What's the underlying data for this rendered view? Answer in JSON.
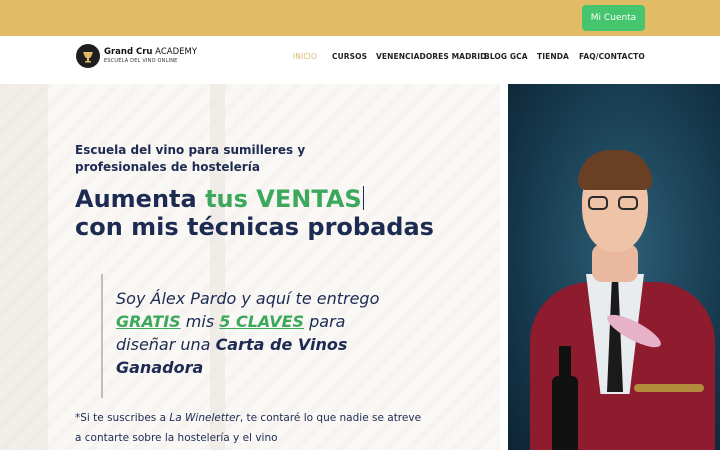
{
  "topbar": {
    "account_label": "Mi Cuenta"
  },
  "logo": {
    "brand_bold": "Grand Cru",
    "brand_rest": " ACADEMY",
    "tagline": "ESCUELA DEL VINO ONLINE"
  },
  "nav": {
    "items": [
      "INICIO",
      "CURSOS",
      "VENENCIADORES MADRID",
      "BLOG GCA",
      "TIENDA",
      "FAQ/CONTACTO"
    ]
  },
  "hero": {
    "subtitle": "Escuela del vino para sumilleres y profesionales de hostelería",
    "headline_part1": "Aumenta ",
    "headline_highlight": "tus VENTAS",
    "headline_line2": "con mis técnicas probadas",
    "quote_part1": "Soy Álex Pardo y aquí te entrego ",
    "quote_gratis": "GRATIS",
    "quote_part2": " mis ",
    "quote_claves": "5 CLAVES",
    "quote_part3": " para diseñar una ",
    "quote_bold": "Carta de Vinos Ganadora",
    "footnote_prefix": "*Si te suscribes a ",
    "footnote_italic": "La Wineletter",
    "footnote_suffix": ", te contaré lo que nadie se atreve a contarte sobre la hostelería y el vino"
  },
  "colors": {
    "topbar": "#e2bb66",
    "account_button": "#45c56d",
    "navy": "#1d2b52",
    "green_accent": "#3ba85c",
    "nav_active": "#e2bb66"
  },
  "icons": {
    "logo": "grand-cru-logo-icon"
  }
}
